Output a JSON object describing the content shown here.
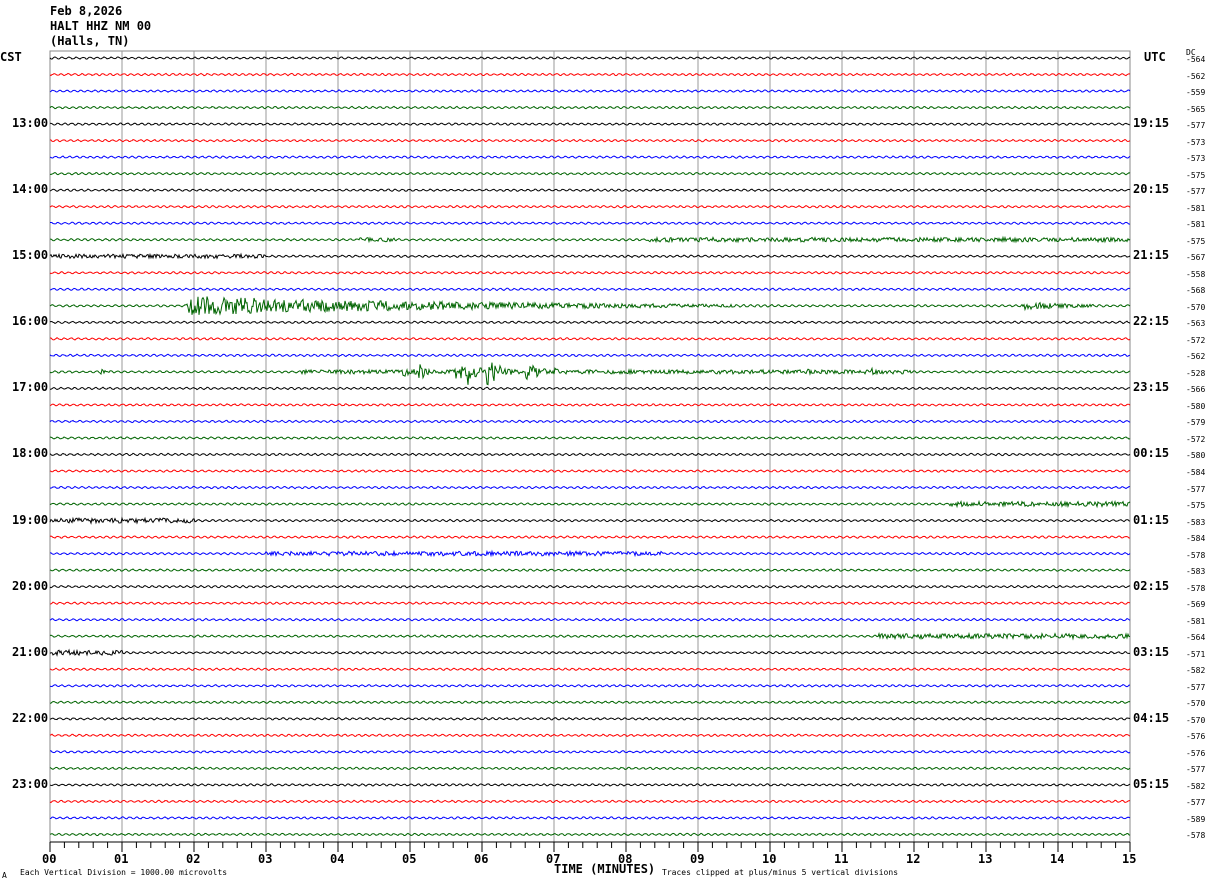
{
  "header": {
    "date": "Feb 8,2026",
    "station": "HALT HHZ NM 00",
    "location": "(Halls, TN)"
  },
  "left_tz": "CST",
  "right_tz": "UTC",
  "dc_label": "DC",
  "footer": {
    "scale": "Each Vertical Division = 1000.00 microvolts",
    "xlabel": "TIME (MINUTES)",
    "clip": "Traces clipped at plus/minus 5 vertical divisions",
    "mark": "A"
  },
  "chart_data": {
    "type": "line",
    "title": "HALT HHZ NM 00 (Halls, TN) Feb 8,2026",
    "xlabel": "TIME (MINUTES)",
    "xlim": [
      0,
      15
    ],
    "x_ticks": [
      "00",
      "01",
      "02",
      "03",
      "04",
      "05",
      "06",
      "07",
      "08",
      "09",
      "10",
      "11",
      "12",
      "13",
      "14",
      "15"
    ],
    "trace_colors": [
      "#000000",
      "#ff0000",
      "#0000ff",
      "#006400"
    ],
    "traces_count": 48,
    "minutes_per_trace": 15,
    "left_labels": [
      {
        "trace": 4,
        "text": "13:00"
      },
      {
        "trace": 8,
        "text": "14:00"
      },
      {
        "trace": 12,
        "text": "15:00"
      },
      {
        "trace": 16,
        "text": "16:00"
      },
      {
        "trace": 20,
        "text": "17:00"
      },
      {
        "trace": 24,
        "text": "18:00"
      },
      {
        "trace": 28,
        "text": "19:00"
      },
      {
        "trace": 32,
        "text": "20:00"
      },
      {
        "trace": 36,
        "text": "21:00"
      },
      {
        "trace": 40,
        "text": "22:00"
      },
      {
        "trace": 44,
        "text": "23:00"
      }
    ],
    "right_labels": [
      {
        "trace": 4,
        "text": "19:15"
      },
      {
        "trace": 8,
        "text": "20:15"
      },
      {
        "trace": 12,
        "text": "21:15"
      },
      {
        "trace": 16,
        "text": "22:15"
      },
      {
        "trace": 20,
        "text": "23:15"
      },
      {
        "trace": 24,
        "text": "00:15"
      },
      {
        "trace": 28,
        "text": "01:15"
      },
      {
        "trace": 32,
        "text": "02:15"
      },
      {
        "trace": 36,
        "text": "03:15"
      },
      {
        "trace": 40,
        "text": "04:15"
      },
      {
        "trace": 44,
        "text": "05:15"
      }
    ],
    "dc_offsets": [
      "-564",
      "-562",
      "-559",
      "-565",
      "-577",
      "-573",
      "-573",
      "-575",
      "-577",
      "-581",
      "-581",
      "-575",
      "-567",
      "-558",
      "-568",
      "-570",
      "-563",
      "-572",
      "-562",
      "-528",
      "-566",
      "-580",
      "-579",
      "-572",
      "-580",
      "-584",
      "-577",
      "-575",
      "-583",
      "-584",
      "-578",
      "-583",
      "-578",
      "-569",
      "-581",
      "-564",
      "-571",
      "-582",
      "-577",
      "-570",
      "-570",
      "-576",
      "-576",
      "-577",
      "-582",
      "-577",
      "-589",
      "-578"
    ],
    "noise_segments": [
      {
        "trace": 11,
        "start": 4.3,
        "end": 4.8,
        "amp": 2
      },
      {
        "trace": 11,
        "start": 8.3,
        "end": 15,
        "amp": 2.2
      },
      {
        "trace": 12,
        "start": 0,
        "end": 3,
        "amp": 2
      },
      {
        "trace": 19,
        "start": 3.5,
        "end": 12,
        "amp": 2
      },
      {
        "trace": 27,
        "start": 12.5,
        "end": 15,
        "amp": 2.5
      },
      {
        "trace": 28,
        "start": 0,
        "end": 2,
        "amp": 2.5
      },
      {
        "trace": 30,
        "start": 3,
        "end": 8.5,
        "amp": 2.2
      },
      {
        "trace": 35,
        "start": 11.5,
        "end": 15,
        "amp": 2.5
      },
      {
        "trace": 36,
        "start": 0,
        "end": 1,
        "amp": 2.5
      }
    ],
    "events": [
      {
        "trace": 15,
        "time": 1.9,
        "amp": 10,
        "decay": 4
      },
      {
        "trace": 15,
        "time": 6.0,
        "amp": 4,
        "decay": 1
      },
      {
        "trace": 15,
        "time": 13.5,
        "amp": 4,
        "decay": 1
      },
      {
        "trace": 19,
        "time": 4.9,
        "amp": 8,
        "decay": 0.15
      },
      {
        "trace": 19,
        "time": 5.1,
        "amp": 14,
        "decay": 0.1
      },
      {
        "trace": 19,
        "time": 5.6,
        "amp": 14,
        "decay": 0.15
      },
      {
        "trace": 19,
        "time": 5.8,
        "amp": 16,
        "decay": 0.15
      },
      {
        "trace": 19,
        "time": 6.05,
        "amp": 17,
        "decay": 0.2
      },
      {
        "trace": 19,
        "time": 6.6,
        "amp": 12,
        "decay": 0.2
      },
      {
        "trace": 19,
        "time": 7.0,
        "amp": 4,
        "decay": 0.2
      },
      {
        "trace": 19,
        "time": 10.5,
        "amp": 3,
        "decay": 0.3
      },
      {
        "trace": 19,
        "time": 11.4,
        "amp": 4,
        "decay": 0.2
      },
      {
        "trace": 19,
        "time": 0.7,
        "amp": 3,
        "decay": 0.2
      }
    ]
  }
}
